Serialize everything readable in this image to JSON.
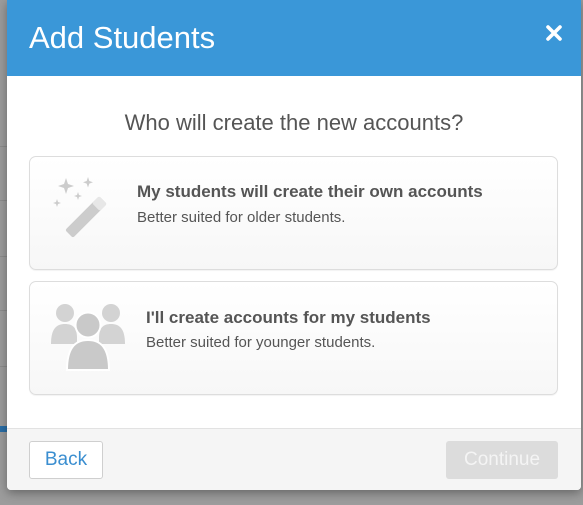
{
  "modal": {
    "title": "Add Students",
    "question": "Who will create the new accounts?"
  },
  "options": [
    {
      "title": "My students will create their own accounts",
      "subtitle": "Better suited for older students.",
      "icon": "magic-wand-icon"
    },
    {
      "title": "I'll create accounts for my students",
      "subtitle": "Better suited for younger students.",
      "icon": "group-icon"
    }
  ],
  "footer": {
    "back_label": "Back",
    "continue_label": "Continue"
  },
  "colors": {
    "header": "#3a97d8",
    "link": "#3a8ed0",
    "disabled_button": "#dcdcdc"
  }
}
